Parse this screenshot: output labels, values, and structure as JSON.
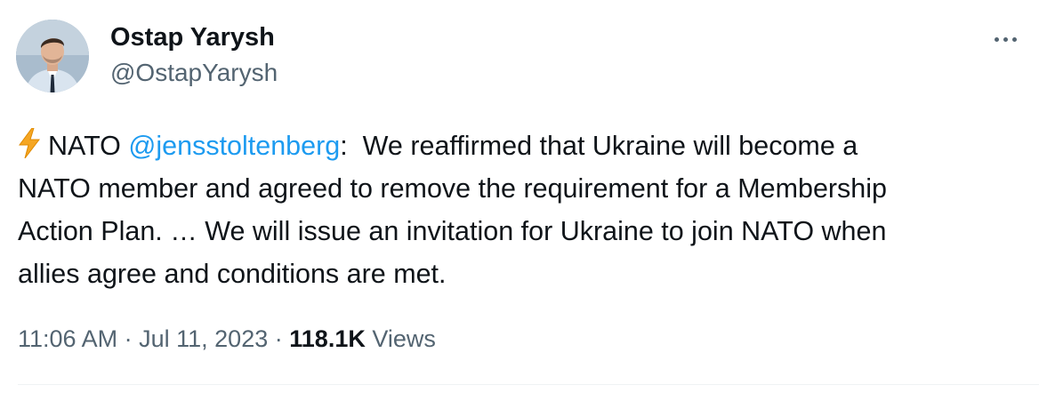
{
  "author": {
    "display_name": "Ostap Yarysh",
    "handle": "@OstapYarysh"
  },
  "tweet": {
    "bolt_icon": "high-voltage-emoji",
    "prefix": "NATO",
    "mention": "@jensstoltenberg",
    "text_line1_rest": ":  We reaffirmed that Ukraine will become a",
    "text_line2": "NATO member and agreed to remove the requirement for a Membership",
    "text_line3": "Action Plan. … We will issue an invitation for Ukraine to join NATO when",
    "text_line4": "allies agree and conditions are met."
  },
  "meta": {
    "time": "11:06 AM",
    "separator": "·",
    "date": "Jul 11, 2023",
    "views_count": "118.1K",
    "views_label": "Views"
  },
  "colors": {
    "mention": "#1d9bf0",
    "secondary_text": "#536471",
    "primary_text": "#0f1419"
  }
}
